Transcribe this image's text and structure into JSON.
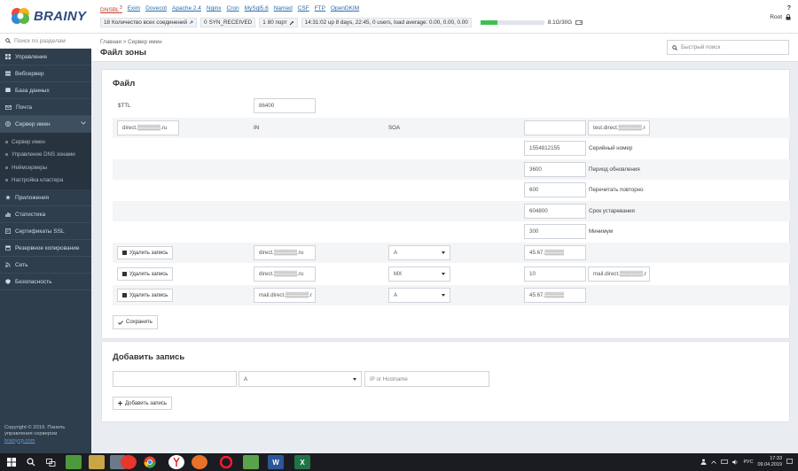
{
  "brand": {
    "name": "BRAINY"
  },
  "top": {
    "services": [
      {
        "label": "DNSBL",
        "sup": "3",
        "color": "#c0392b"
      },
      {
        "label": "Exim"
      },
      {
        "label": "Dovecot"
      },
      {
        "label": "Apache 2.4"
      },
      {
        "label": "Nginx"
      },
      {
        "label": "Cron"
      },
      {
        "label": "MySql5.6"
      },
      {
        "label": "Named"
      },
      {
        "label": "CSF"
      },
      {
        "label": "FTP"
      },
      {
        "label": "OpenDKIM"
      }
    ],
    "connections_count": "18",
    "connections_label": "Количество всех соединений",
    "syn_count": "0",
    "syn_label": "SYN_RECEIVED",
    "ports_count": "1",
    "ports_label": "80 порт",
    "uptime": "14:31:02 up 8 days, 22:45, 0 users, load average: 0.00, 0.00, 0.00",
    "disk_label": "8.1G/30G",
    "disk_used_fraction": 0.27,
    "user": "Root",
    "help": "?"
  },
  "sidebar": {
    "search_placeholder": "Поиск по разделам",
    "items": [
      {
        "label": "Управление"
      },
      {
        "label": "Вебсервер"
      },
      {
        "label": "База данных"
      },
      {
        "label": "Почта"
      },
      {
        "label": "Сервер имен"
      },
      {
        "label": "Приложения"
      },
      {
        "label": "Статистика"
      },
      {
        "label": "Сертификаты SSL"
      },
      {
        "label": "Резервное копирование"
      },
      {
        "label": "Сеть"
      },
      {
        "label": "Безопасность"
      }
    ],
    "submenu": [
      {
        "label": "Сервер имен"
      },
      {
        "label": "Управление DNS зонами"
      },
      {
        "label": "Неймсерверы"
      },
      {
        "label": "Настройка кластера"
      }
    ],
    "copyright_line1": "Copyright © 2019. Панель",
    "copyright_line2": "управления сервером",
    "copyright_link": "brainycp.com"
  },
  "header": {
    "breadcrumb_home": "Главная",
    "breadcrumb_sep": ">",
    "breadcrumb_current": "Сервер имен",
    "title": "Файл зоны",
    "quick_search_placeholder": "Быстрый поиск"
  },
  "zone": {
    "title": "Файл",
    "ttl_label": "$TTL",
    "ttl_value": "86400",
    "soa_name": "direct.▒▒▒▒▒▒.ru",
    "soa_class": "IN",
    "soa_type": "SOA",
    "soa_primary": "",
    "soa_email": "test.direct.▒▒▒▒▒▒.r",
    "serial_value": "1554812155",
    "serial_label": "Серийный номер",
    "refresh_value": "3600",
    "refresh_label": "Период обновления",
    "retry_value": "600",
    "retry_label": "Перечитать повторно",
    "expire_value": "604800",
    "expire_label": "Срок устаревания",
    "minimum_value": "300",
    "minimum_label": "Минимум",
    "records": [
      {
        "delete_label": "Удалить запись",
        "name": "direct.▒▒▒▒▒▒.ru",
        "type": "A",
        "value": "45.67.▒▒▒▒▒",
        "extra": ""
      },
      {
        "delete_label": "Удалить запись",
        "name": "direct.▒▒▒▒▒▒.ru",
        "type": "MX",
        "value": "10",
        "extra": "mail.direct.▒▒▒▒▒▒.r"
      },
      {
        "delete_label": "Удалить запись",
        "name": "mail.direct.▒▒▒▒▒▒.r",
        "type": "A",
        "value": "45.67.▒▒▒▒▒",
        "extra": ""
      }
    ],
    "save_label": "Сохранить"
  },
  "add": {
    "title": "Добавить запись",
    "name_value": "",
    "type_value": "A",
    "ip_placeholder": "IP or Hostname",
    "add_label": "Добавить запись"
  },
  "taskbar": {
    "lang": "РУС",
    "time": "17:33",
    "date": "09.04.2019"
  }
}
